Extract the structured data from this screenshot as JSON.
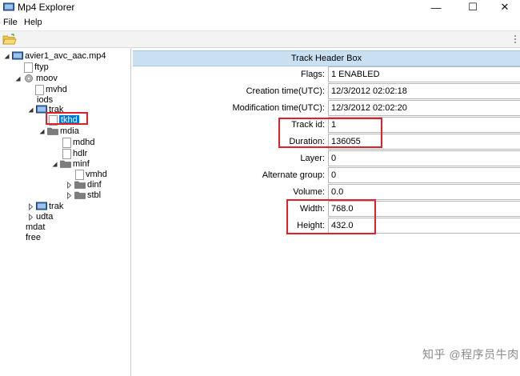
{
  "window": {
    "title": "Mp4 Explorer",
    "minimize": "—",
    "maximize": "☐",
    "close": "✕"
  },
  "menu": {
    "file": "File",
    "help": "Help"
  },
  "tree": {
    "root": "avier1_avc_aac.mp4",
    "ftyp": "ftyp",
    "moov": "moov",
    "mvhd": "mvhd",
    "iods": "iods",
    "trak1": "trak",
    "tkhd": "tkhd",
    "mdia": "mdia",
    "mdhd": "mdhd",
    "hdlr": "hdlr",
    "minf": "minf",
    "vmhd": "vmhd",
    "dinf": "dinf",
    "stbl": "stbl",
    "trak2": "trak",
    "udta": "udta",
    "mdat": "mdat",
    "free": "free"
  },
  "details": {
    "header": "Track Header Box",
    "rows": [
      {
        "label": "Flags:",
        "value": "1 ENABLED"
      },
      {
        "label": "Creation time(UTC):",
        "value": "12/3/2012 02:02:18"
      },
      {
        "label": "Modification time(UTC):",
        "value": "12/3/2012 02:02:20"
      },
      {
        "label": "Track id:",
        "value": "1"
      },
      {
        "label": "Duration:",
        "value": "136055"
      },
      {
        "label": "Layer:",
        "value": "0"
      },
      {
        "label": "Alternate group:",
        "value": "0"
      },
      {
        "label": "Volume:",
        "value": "0.0"
      },
      {
        "label": "Width:",
        "value": "768.0"
      },
      {
        "label": "Height:",
        "value": "432.0"
      }
    ]
  },
  "watermark": {
    "text": "知乎 @程序员牛肉"
  },
  "colors": {
    "selection": "#0078d7",
    "header_bg": "#c9dff2",
    "callout": "#e0202a"
  }
}
